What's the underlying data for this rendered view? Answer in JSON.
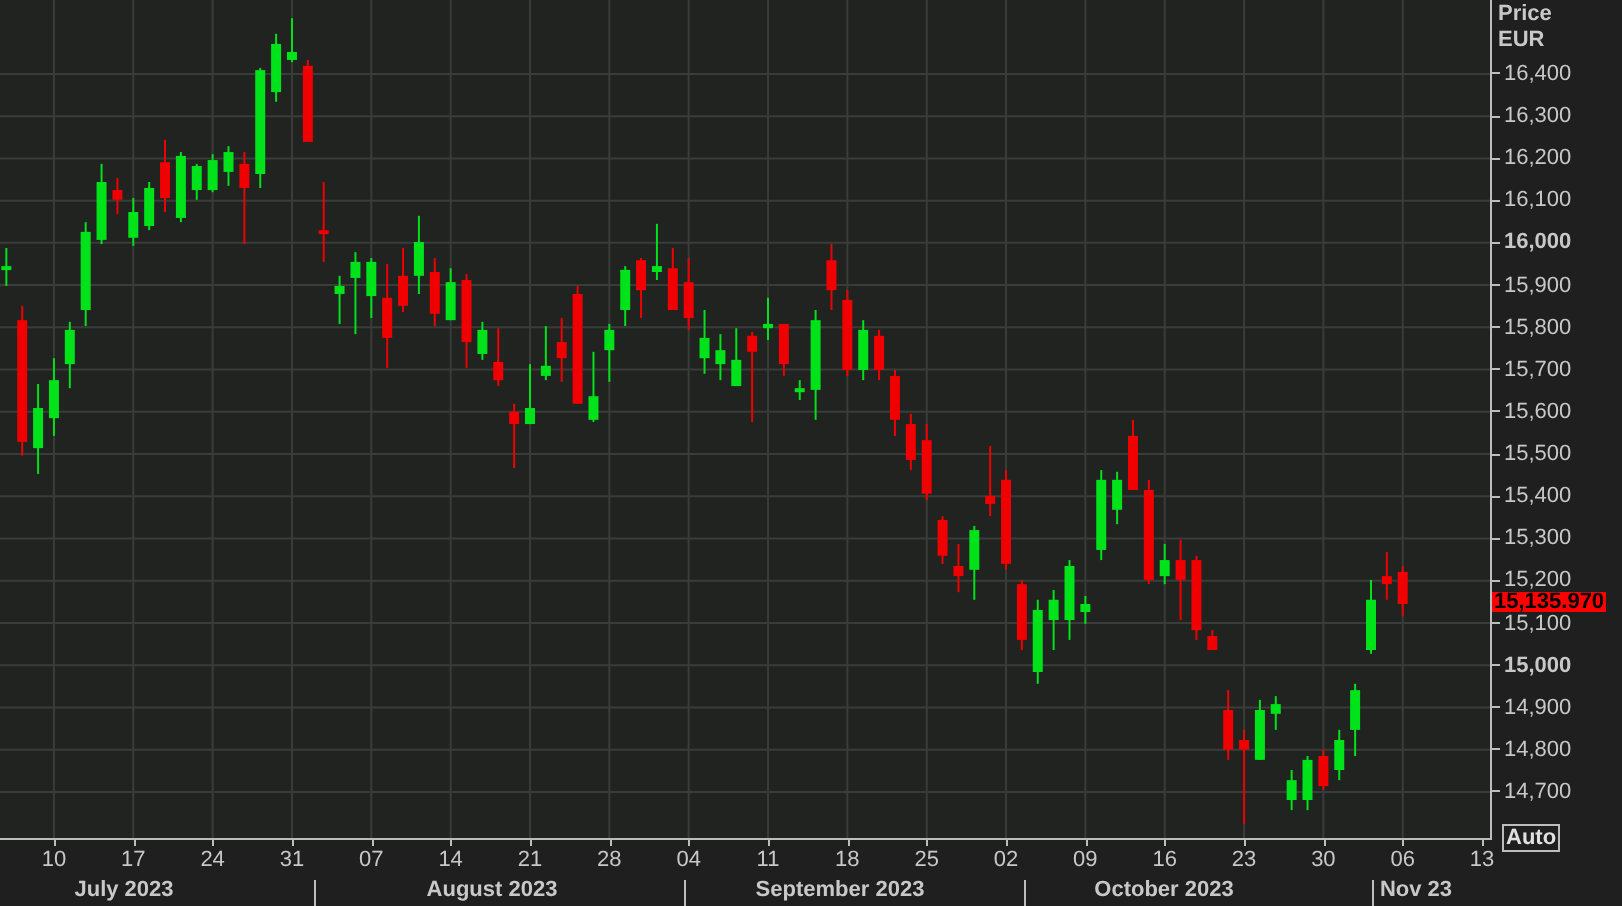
{
  "price_axis": {
    "title": [
      "Price",
      "EUR"
    ],
    "current_price": "15,135.970",
    "auto_button": "Auto"
  },
  "chart": {
    "chart_data": {
      "type": "candlestick",
      "grid": true,
      "ylim": [
        14591,
        16575
      ],
      "categories": [
        null,
        null,
        null,
        "10",
        null,
        null,
        null,
        null,
        "17",
        null,
        null,
        null,
        null,
        "24",
        null,
        null,
        null,
        null,
        "31",
        null,
        null,
        null,
        null,
        "07",
        null,
        null,
        null,
        null,
        "14",
        null,
        null,
        null,
        null,
        "21",
        null,
        null,
        null,
        null,
        "28",
        null,
        null,
        null,
        null,
        "04",
        null,
        null,
        null,
        null,
        "11",
        null,
        null,
        null,
        null,
        "18",
        null,
        null,
        null,
        null,
        "25",
        null,
        null,
        null,
        null,
        "02",
        null,
        null,
        null,
        null,
        "09",
        null,
        null,
        null,
        null,
        "16",
        null,
        null,
        null,
        null,
        "23",
        null,
        null,
        null,
        null,
        "30",
        null,
        null,
        null,
        null,
        "06",
        null,
        null,
        null,
        null,
        "13"
      ],
      "ohlc": [
        [
          15936,
          15988,
          15898,
          15945
        ],
        [
          15817,
          15851,
          15496,
          15529
        ],
        [
          15514,
          15666,
          15453,
          15609
        ],
        [
          15585,
          15727,
          15543,
          15675
        ],
        [
          15713,
          15813,
          15656,
          15794
        ],
        [
          15841,
          16049,
          15803,
          16026
        ],
        [
          16007,
          16187,
          15997,
          16144
        ],
        [
          16125,
          16154,
          16068,
          16102
        ],
        [
          16012,
          16106,
          15993,
          16073
        ],
        [
          16040,
          16144,
          16030,
          16130
        ],
        [
          16191,
          16244,
          16073,
          16106
        ],
        [
          16059,
          16215,
          16049,
          16206
        ],
        [
          16125,
          16187,
          16102,
          16182
        ],
        [
          16125,
          16210,
          16120,
          16196
        ],
        [
          16168,
          16229,
          16135,
          16215
        ],
        [
          16187,
          16215,
          15997,
          16130
        ],
        [
          16163,
          16414,
          16130,
          16409
        ],
        [
          16357,
          16495,
          16334,
          16471
        ],
        [
          16433,
          16532,
          16428,
          16452
        ],
        [
          16419,
          16433,
          16239,
          16239
        ],
        [
          16030,
          16144,
          15955,
          16021
        ],
        [
          15879,
          15922,
          15808,
          15898
        ],
        [
          15917,
          15978,
          15784,
          15955
        ],
        [
          15874,
          15964,
          15822,
          15955
        ],
        [
          15870,
          15950,
          15704,
          15775
        ],
        [
          15922,
          15988,
          15836,
          15851
        ],
        [
          15922,
          16064,
          15879,
          16002
        ],
        [
          15931,
          15964,
          15803,
          15832
        ],
        [
          15817,
          15940,
          15817,
          15907
        ],
        [
          15912,
          15926,
          15704,
          15765
        ],
        [
          15737,
          15813,
          15723,
          15794
        ],
        [
          15718,
          15798,
          15661,
          15675
        ],
        [
          15600,
          15619,
          15467,
          15571
        ],
        [
          15571,
          15713,
          15571,
          15609
        ],
        [
          15685,
          15803,
          15675,
          15709
        ],
        [
          15765,
          15822,
          15671,
          15727
        ],
        [
          15879,
          15898,
          15619,
          15619
        ],
        [
          15581,
          15742,
          15576,
          15637
        ],
        [
          15746,
          15808,
          15671,
          15794
        ],
        [
          15841,
          15945,
          15803,
          15936
        ],
        [
          15959,
          15964,
          15822,
          15888
        ],
        [
          15931,
          16045,
          15912,
          15945
        ],
        [
          15940,
          15988,
          15841,
          15841
        ],
        [
          15907,
          15964,
          15794,
          15822
        ],
        [
          15727,
          15841,
          15690,
          15775
        ],
        [
          15713,
          15784,
          15675,
          15746
        ],
        [
          15661,
          15798,
          15661,
          15723
        ],
        [
          15780,
          15789,
          15576,
          15742
        ],
        [
          15798,
          15870,
          15770,
          15808
        ],
        [
          15808,
          15808,
          15685,
          15713
        ],
        [
          15647,
          15675,
          15628,
          15656
        ],
        [
          15652,
          15841,
          15581,
          15817
        ],
        [
          15959,
          15997,
          15841,
          15888
        ],
        [
          15865,
          15888,
          15685,
          15699
        ],
        [
          15699,
          15817,
          15675,
          15794
        ],
        [
          15780,
          15794,
          15675,
          15699
        ],
        [
          15685,
          15699,
          15543,
          15581
        ],
        [
          15571,
          15595,
          15462,
          15486
        ],
        [
          15533,
          15571,
          15391,
          15406
        ],
        [
          15344,
          15353,
          15240,
          15259
        ],
        [
          15235,
          15287,
          15173,
          15211
        ],
        [
          15226,
          15330,
          15155,
          15320
        ],
        [
          15401,
          15519,
          15353,
          15382
        ],
        [
          15439,
          15462,
          15226,
          15240
        ],
        [
          15192,
          15202,
          15036,
          15060
        ],
        [
          14984,
          15155,
          14956,
          15131
        ],
        [
          15107,
          15178,
          15036,
          15155
        ],
        [
          15107,
          15249,
          15060,
          15235
        ],
        [
          15126,
          15164,
          15098,
          15145
        ],
        [
          15273,
          15462,
          15249,
          15439
        ],
        [
          15368,
          15458,
          15334,
          15439
        ],
        [
          15543,
          15581,
          15415,
          15415
        ],
        [
          15415,
          15439,
          15192,
          15202
        ],
        [
          15211,
          15287,
          15192,
          15249
        ],
        [
          15249,
          15297,
          15107,
          15202
        ],
        [
          15249,
          15259,
          15060,
          15083
        ],
        [
          15069,
          15083,
          15036,
          15036
        ],
        [
          14894,
          14941,
          14776,
          14800
        ],
        [
          14823,
          14847,
          14624,
          14800
        ],
        [
          14776,
          14918,
          14776,
          14894
        ],
        [
          14885,
          14927,
          14847,
          14908
        ],
        [
          14681,
          14752,
          14657,
          14728
        ],
        [
          14681,
          14785,
          14657,
          14776
        ],
        [
          14785,
          14800,
          14705,
          14714
        ],
        [
          14752,
          14847,
          14728,
          14823
        ],
        [
          14847,
          14956,
          14785,
          14941
        ],
        [
          15036,
          15202,
          15027,
          15155
        ],
        [
          15211,
          15268,
          15155,
          15192
        ],
        [
          15221,
          15235,
          15117,
          15145
        ],
        null,
        null,
        null,
        null,
        null
      ],
      "yticks": [
        {
          "value": 16400,
          "label": "16,400"
        },
        {
          "value": 16300,
          "label": "16,300"
        },
        {
          "value": 16200,
          "label": "16,200"
        },
        {
          "value": 16100,
          "label": "16,100"
        },
        {
          "value": 16000,
          "label": "16,000"
        },
        {
          "value": 15900,
          "label": "15,900"
        },
        {
          "value": 15800,
          "label": "15,800"
        },
        {
          "value": 15700,
          "label": "15,700"
        },
        {
          "value": 15600,
          "label": "15,600"
        },
        {
          "value": 15500,
          "label": "15,500"
        },
        {
          "value": 15400,
          "label": "15,400"
        },
        {
          "value": 15300,
          "label": "15,300"
        },
        {
          "value": 15200,
          "label": "15,200"
        },
        {
          "value": 15100,
          "label": "15,100"
        },
        {
          "value": 15000,
          "label": "15,000"
        },
        {
          "value": 14900,
          "label": "14,900"
        },
        {
          "value": 14800,
          "label": "14,800"
        },
        {
          "value": 14700,
          "label": "14,700"
        }
      ]
    }
  },
  "date_axis": {
    "months": [
      "July 2023",
      "August 2023",
      "September 2023",
      "October 2023",
      "Nov 23"
    ]
  }
}
